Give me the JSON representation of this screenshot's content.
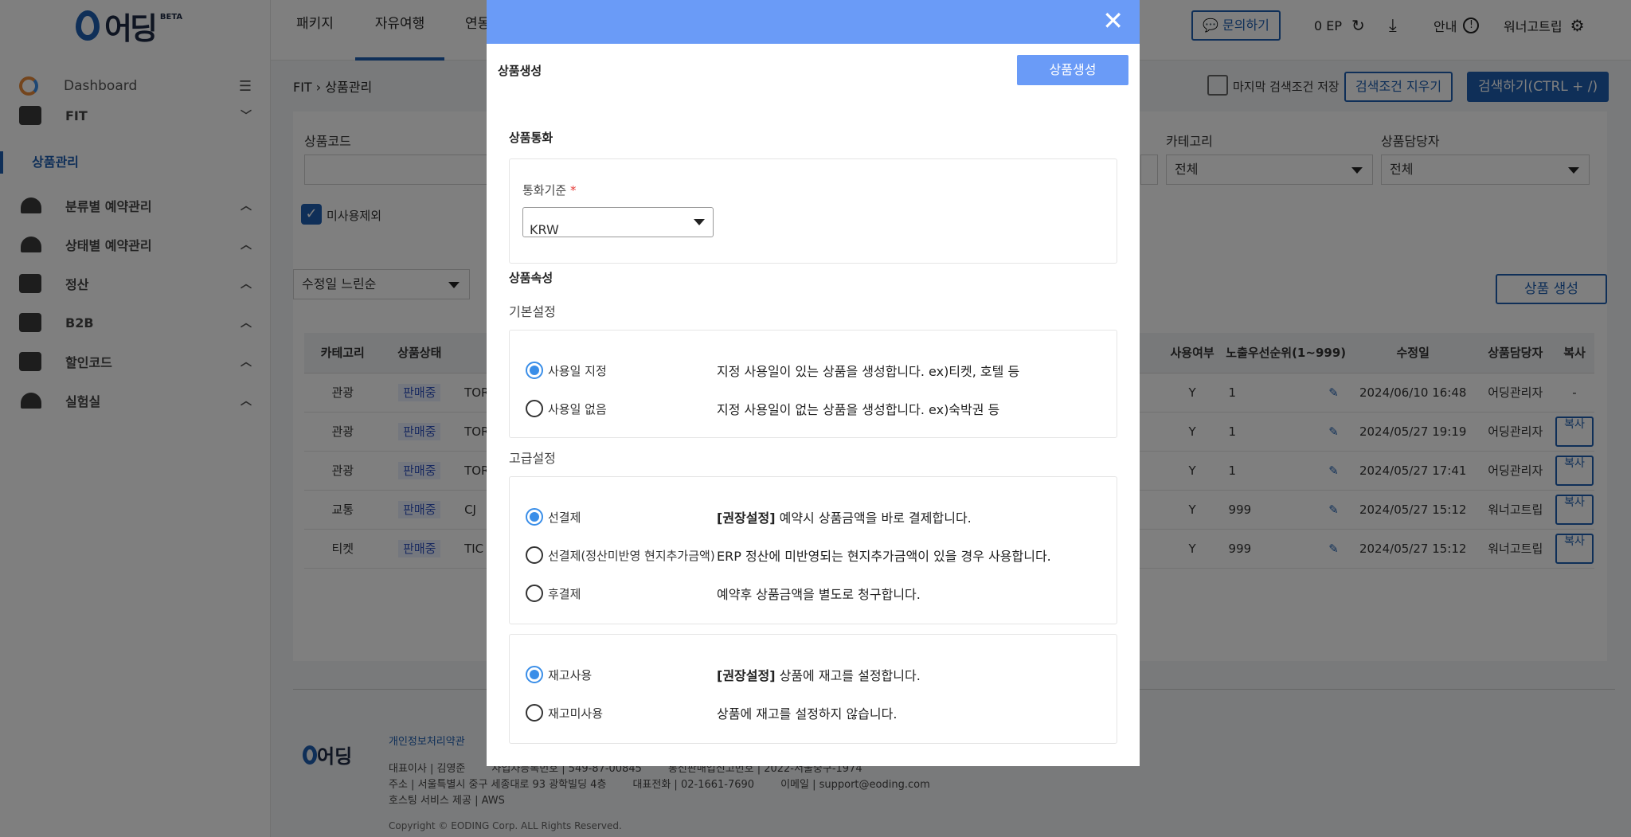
{
  "app": {
    "logo_text": "어딩",
    "logo_badge": "BETA",
    "dashboard_label": "Dashboard"
  },
  "sidebar": {
    "items": [
      {
        "label": "FIT",
        "icon": "briefcase-icon"
      },
      {
        "label": "상품관리",
        "active": true
      },
      {
        "label": "분류별 예약관리",
        "icon": "bell-icon"
      },
      {
        "label": "상태별 예약관리",
        "icon": "bell-icon"
      },
      {
        "label": "정산",
        "icon": "calculator-icon"
      },
      {
        "label": "B2B",
        "icon": "document-icon"
      },
      {
        "label": "할인코드",
        "icon": "tag-icon"
      },
      {
        "label": "실험실",
        "icon": "bell-icon"
      }
    ]
  },
  "topbar": {
    "tabs": [
      "패키지",
      "자유여행",
      "연동"
    ],
    "active_tab": "자유여행",
    "inquiry_button": "문의하기",
    "points": "0 EP",
    "guide": "안내",
    "user": "워너고트립"
  },
  "breadcrumb": [
    "FIT",
    "상품관리"
  ],
  "search": {
    "save_last_label": "마지막 검색조건 저장",
    "clear_button": "검색조건 지우기",
    "search_button": "검색하기(CTRL + /)",
    "product_code_label": "상품코드",
    "category_label": "카테고리",
    "category_value": "전체",
    "manager_label": "상품담당자",
    "manager_value": "전체",
    "exclude_unused_label": "미사용제외"
  },
  "list": {
    "sort_value": "수정일 느린순",
    "create_button": "상품 생성",
    "columns_left": [
      "카테고리",
      "상품상태"
    ],
    "columns_right": [
      "사용여부",
      "노출우선순위(1~999)",
      "수정일",
      "상품담당자",
      "복사"
    ],
    "rows": [
      {
        "category": "관광",
        "status": "판매중",
        "code": "TOR",
        "use": "Y",
        "priority": "1",
        "date": "2024/06/10 16:48",
        "manager": "어딩관리자",
        "copy": "-"
      },
      {
        "category": "관광",
        "status": "판매중",
        "code": "TOR",
        "use": "Y",
        "priority": "1",
        "date": "2024/05/27 19:19",
        "manager": "어딩관리자",
        "copy": "복사"
      },
      {
        "category": "관광",
        "status": "판매중",
        "code": "TOR",
        "use": "Y",
        "priority": "1",
        "date": "2024/05/27 17:41",
        "manager": "어딩관리자",
        "copy": "복사"
      },
      {
        "category": "교통",
        "status": "판매중",
        "code": "CJ",
        "use": "Y",
        "priority": "999",
        "date": "2024/05/27 15:12",
        "manager": "워너고트립",
        "copy": "복사"
      },
      {
        "category": "티켓",
        "status": "판매중",
        "code": "TIC",
        "use": "Y",
        "priority": "999",
        "date": "2024/05/27 15:12",
        "manager": "워너고트립",
        "copy": "복사"
      }
    ]
  },
  "footer": {
    "privacy_link": "개인정보처리약관",
    "line1": "대표이사 | 김영준        사업자등록번호 | 549-87-00845        통신판매업신고번호 | 2022-서울중구-1974",
    "line2": "주소 | 서울특별시 중구 세종대로 93 광학빌딩 4층        대표전화 | 02-1661-7690        이메일 | support@eoding.com",
    "line3": "호스팅 서비스 제공 | AWS",
    "copyright": "Copyright © EODING Corp. ALL Rights Reserved."
  },
  "modal": {
    "title": "상품생성",
    "create_button": "상품생성",
    "currency_section": "상품통화",
    "currency_label": "통화기준",
    "currency_required": "*",
    "currency_value": "KRW",
    "attr_section": "상품속성",
    "basic_settings": "기본설정",
    "basic_options": [
      {
        "label": "사용일 지정",
        "desc": "지정 사용일이 있는 상품을 생성합니다. ex)티켓, 호텔 등",
        "checked": true
      },
      {
        "label": "사용일 없음",
        "desc": "지정 사용일이 없는 상품을 생성합니다. ex)숙박권 등",
        "checked": false
      }
    ],
    "advanced_settings": "고급설정",
    "payment_options": [
      {
        "label": "선결제",
        "strong": "[권장설정]",
        "desc": " 예약시 상품금액을 바로 결제합니다.",
        "checked": true
      },
      {
        "label": "선결제(정산미반영 현지추가금액)",
        "strong": "",
        "desc": "ERP 정산에 미반영되는 현지추가금액이 있을 경우 사용합니다.",
        "checked": false
      },
      {
        "label": "후결제",
        "strong": "",
        "desc": "예약후 상품금액을 별도로 청구합니다.",
        "checked": false
      }
    ],
    "stock_options": [
      {
        "label": "재고사용",
        "strong": "[권장설정]",
        "desc": " 상품에 재고를 설정합니다.",
        "checked": true
      },
      {
        "label": "재고미사용",
        "strong": "",
        "desc": "상품에 재고를 설정하지 않습니다.",
        "checked": false
      }
    ]
  }
}
